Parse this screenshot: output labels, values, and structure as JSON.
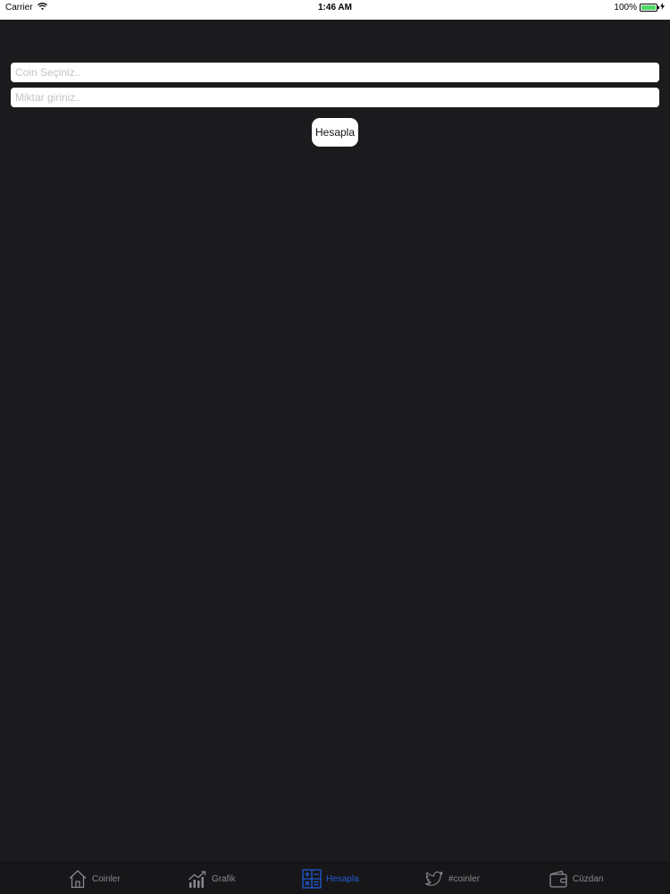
{
  "status_bar": {
    "carrier": "Carrier",
    "time": "1:46 AM",
    "battery": "100%",
    "battery_level": 1.0
  },
  "form": {
    "coin_placeholder": "Coin Seçiniz..",
    "coin_value": "",
    "amount_placeholder": "Miktar giriniz..",
    "amount_value": "",
    "calculate_label": "Hesapla"
  },
  "tabs": [
    {
      "label": "Coinler",
      "icon": "home-icon",
      "active": false
    },
    {
      "label": "Grafik",
      "icon": "chart-icon",
      "active": false
    },
    {
      "label": "Hesapla",
      "icon": "calculator-icon",
      "active": true
    },
    {
      "label": "#coinler",
      "icon": "twitter-icon",
      "active": false
    },
    {
      "label": "Cüzdan",
      "icon": "wallet-icon",
      "active": false
    }
  ],
  "colors": {
    "background": "#1b1b1d",
    "tab_active": "#1f5ad6",
    "tab_inactive": "#8a8a8e",
    "battery": "#4cd964"
  }
}
